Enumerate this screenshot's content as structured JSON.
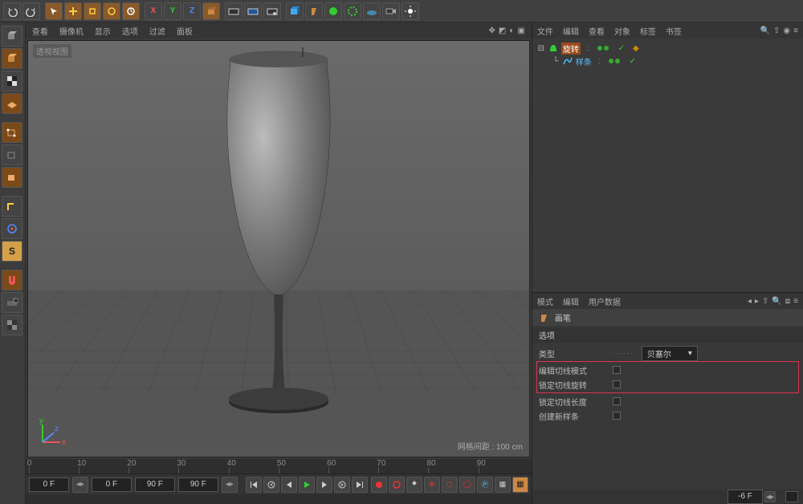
{
  "top_toolbar": {
    "undo": "undo",
    "redo": "redo",
    "select": "select",
    "move": "move",
    "scale": "scale",
    "rotate": "rotate",
    "recent": "recent",
    "x": "X",
    "y": "Y",
    "z": "Z",
    "cube": "cube",
    "render": "render",
    "renderregion": "render-region",
    "rendersettings": "render-settings",
    "primitive": "primitive",
    "pen": "pen",
    "generator": "generator",
    "deformer": "deformer",
    "environment": "environment",
    "camera": "camera",
    "light": "light"
  },
  "left_toolbar": [
    "live-select",
    "model-mode",
    "texture-mode",
    "uv-mode",
    "workplane",
    "point-mode",
    "edge-mode",
    "polygon-mode",
    "axis-mode",
    "tweak-mode",
    "snap-s",
    "magnet",
    "soft-select",
    "checker"
  ],
  "viewport_menu": {
    "items": [
      "查看",
      "摄像机",
      "显示",
      "选项",
      "过滤",
      "面板"
    ],
    "label": "透视视图",
    "grid_info": "网格间距 : 100 cm"
  },
  "ruler": {
    "ticks": [
      "0",
      "10",
      "20",
      "30",
      "40",
      "50",
      "60",
      "70",
      "80",
      "90"
    ]
  },
  "timeline": {
    "start": "0 F",
    "cur": "0 F",
    "end": "90 F",
    "end2": "90 F",
    "frame_right": "-6 F"
  },
  "object_panel": {
    "menu": [
      "文件",
      "编辑",
      "查看",
      "对象",
      "标签",
      "书签"
    ],
    "tree": [
      {
        "name": "旋转",
        "icon": "lathe",
        "sel": true,
        "expand": "−"
      },
      {
        "name": "样条",
        "icon": "spline",
        "sel": false,
        "indent": 1
      }
    ]
  },
  "attr_panel": {
    "menu": [
      "模式",
      "编辑",
      "用户数据"
    ],
    "title": "画笔",
    "section": "选项",
    "rows": [
      {
        "label": "类型",
        "type": "dropdown",
        "value": "贝塞尔"
      },
      {
        "label": "编辑切线模式",
        "type": "check",
        "hl": true
      },
      {
        "label": "锁定切线旋转",
        "type": "check",
        "hl": true
      },
      {
        "label": "锁定切线长度",
        "type": "check"
      },
      {
        "label": "创建新样条",
        "type": "check"
      }
    ]
  }
}
